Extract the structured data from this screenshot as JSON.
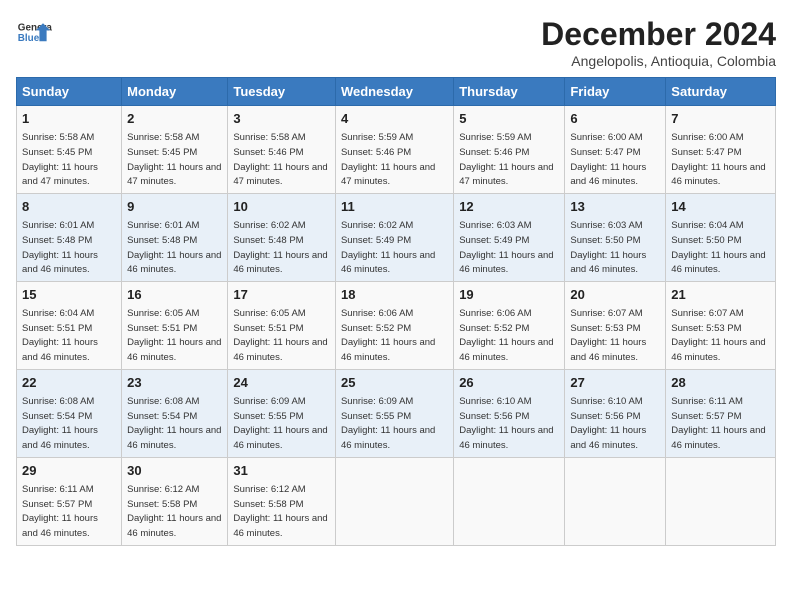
{
  "logo": {
    "line1": "General",
    "line2": "Blue"
  },
  "title": "December 2024",
  "subtitle": "Angelopolis, Antioquia, Colombia",
  "days_of_week": [
    "Sunday",
    "Monday",
    "Tuesday",
    "Wednesday",
    "Thursday",
    "Friday",
    "Saturday"
  ],
  "weeks": [
    [
      {
        "day": 1,
        "info": "Sunrise: 5:58 AM\nSunset: 5:45 PM\nDaylight: 11 hours and 47 minutes."
      },
      {
        "day": 2,
        "info": "Sunrise: 5:58 AM\nSunset: 5:45 PM\nDaylight: 11 hours and 47 minutes."
      },
      {
        "day": 3,
        "info": "Sunrise: 5:58 AM\nSunset: 5:46 PM\nDaylight: 11 hours and 47 minutes."
      },
      {
        "day": 4,
        "info": "Sunrise: 5:59 AM\nSunset: 5:46 PM\nDaylight: 11 hours and 47 minutes."
      },
      {
        "day": 5,
        "info": "Sunrise: 5:59 AM\nSunset: 5:46 PM\nDaylight: 11 hours and 47 minutes."
      },
      {
        "day": 6,
        "info": "Sunrise: 6:00 AM\nSunset: 5:47 PM\nDaylight: 11 hours and 46 minutes."
      },
      {
        "day": 7,
        "info": "Sunrise: 6:00 AM\nSunset: 5:47 PM\nDaylight: 11 hours and 46 minutes."
      }
    ],
    [
      {
        "day": 8,
        "info": "Sunrise: 6:01 AM\nSunset: 5:48 PM\nDaylight: 11 hours and 46 minutes."
      },
      {
        "day": 9,
        "info": "Sunrise: 6:01 AM\nSunset: 5:48 PM\nDaylight: 11 hours and 46 minutes."
      },
      {
        "day": 10,
        "info": "Sunrise: 6:02 AM\nSunset: 5:48 PM\nDaylight: 11 hours and 46 minutes."
      },
      {
        "day": 11,
        "info": "Sunrise: 6:02 AM\nSunset: 5:49 PM\nDaylight: 11 hours and 46 minutes."
      },
      {
        "day": 12,
        "info": "Sunrise: 6:03 AM\nSunset: 5:49 PM\nDaylight: 11 hours and 46 minutes."
      },
      {
        "day": 13,
        "info": "Sunrise: 6:03 AM\nSunset: 5:50 PM\nDaylight: 11 hours and 46 minutes."
      },
      {
        "day": 14,
        "info": "Sunrise: 6:04 AM\nSunset: 5:50 PM\nDaylight: 11 hours and 46 minutes."
      }
    ],
    [
      {
        "day": 15,
        "info": "Sunrise: 6:04 AM\nSunset: 5:51 PM\nDaylight: 11 hours and 46 minutes."
      },
      {
        "day": 16,
        "info": "Sunrise: 6:05 AM\nSunset: 5:51 PM\nDaylight: 11 hours and 46 minutes."
      },
      {
        "day": 17,
        "info": "Sunrise: 6:05 AM\nSunset: 5:51 PM\nDaylight: 11 hours and 46 minutes."
      },
      {
        "day": 18,
        "info": "Sunrise: 6:06 AM\nSunset: 5:52 PM\nDaylight: 11 hours and 46 minutes."
      },
      {
        "day": 19,
        "info": "Sunrise: 6:06 AM\nSunset: 5:52 PM\nDaylight: 11 hours and 46 minutes."
      },
      {
        "day": 20,
        "info": "Sunrise: 6:07 AM\nSunset: 5:53 PM\nDaylight: 11 hours and 46 minutes."
      },
      {
        "day": 21,
        "info": "Sunrise: 6:07 AM\nSunset: 5:53 PM\nDaylight: 11 hours and 46 minutes."
      }
    ],
    [
      {
        "day": 22,
        "info": "Sunrise: 6:08 AM\nSunset: 5:54 PM\nDaylight: 11 hours and 46 minutes."
      },
      {
        "day": 23,
        "info": "Sunrise: 6:08 AM\nSunset: 5:54 PM\nDaylight: 11 hours and 46 minutes."
      },
      {
        "day": 24,
        "info": "Sunrise: 6:09 AM\nSunset: 5:55 PM\nDaylight: 11 hours and 46 minutes."
      },
      {
        "day": 25,
        "info": "Sunrise: 6:09 AM\nSunset: 5:55 PM\nDaylight: 11 hours and 46 minutes."
      },
      {
        "day": 26,
        "info": "Sunrise: 6:10 AM\nSunset: 5:56 PM\nDaylight: 11 hours and 46 minutes."
      },
      {
        "day": 27,
        "info": "Sunrise: 6:10 AM\nSunset: 5:56 PM\nDaylight: 11 hours and 46 minutes."
      },
      {
        "day": 28,
        "info": "Sunrise: 6:11 AM\nSunset: 5:57 PM\nDaylight: 11 hours and 46 minutes."
      }
    ],
    [
      {
        "day": 29,
        "info": "Sunrise: 6:11 AM\nSunset: 5:57 PM\nDaylight: 11 hours and 46 minutes."
      },
      {
        "day": 30,
        "info": "Sunrise: 6:12 AM\nSunset: 5:58 PM\nDaylight: 11 hours and 46 minutes."
      },
      {
        "day": 31,
        "info": "Sunrise: 6:12 AM\nSunset: 5:58 PM\nDaylight: 11 hours and 46 minutes."
      },
      null,
      null,
      null,
      null
    ]
  ]
}
